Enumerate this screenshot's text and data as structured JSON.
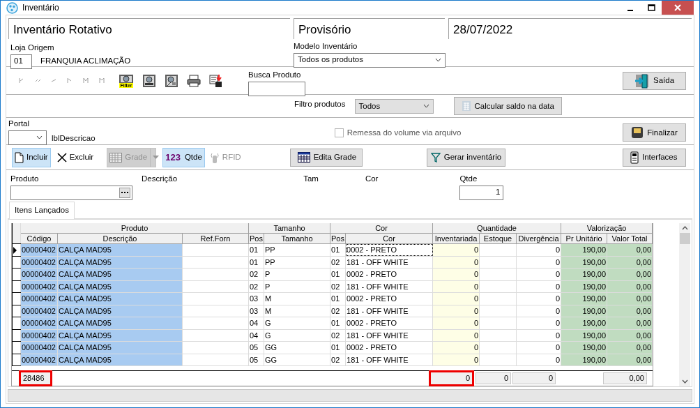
{
  "window": {
    "title": "Inventário"
  },
  "header": {
    "title": "Inventário Rotativo",
    "status": "Provisório",
    "date": "28/07/2022"
  },
  "loja": {
    "label": "Loja Origem",
    "code": "01",
    "name": "FRANQUIA ACLIMAÇÃO"
  },
  "modelo": {
    "label": "Modelo Inventário",
    "value": "Todos os produtos"
  },
  "nav_buttons": [
    {
      "kind": "first",
      "disabled": true
    },
    {
      "kind": "prior",
      "disabled": true
    },
    {
      "kind": "next",
      "disabled": true
    },
    {
      "kind": "last",
      "disabled": true
    },
    {
      "kind": "insert",
      "disabled": true
    },
    {
      "kind": "delete",
      "disabled": true
    }
  ],
  "tool_buttons": [
    {
      "kind": "filter",
      "label": "Filter"
    },
    {
      "kind": "report"
    },
    {
      "kind": "report-edit"
    },
    {
      "kind": "print"
    },
    {
      "kind": "export"
    }
  ],
  "busca": {
    "label": "Busca Produto"
  },
  "exit_button": {
    "label": "Saída"
  },
  "filter": {
    "label": "Filtro produtos",
    "value": "Todos"
  },
  "calc_button": {
    "label": "Calcular saldo na data"
  },
  "portal": {
    "label": "Portal",
    "description": "lblDescricao"
  },
  "remessa": {
    "label": "Remessa do volume via arquivo",
    "checked": false
  },
  "finish_button": {
    "label": "Finalizar"
  },
  "actions": [
    {
      "kind": "new",
      "label": "Incluir",
      "selected": true,
      "disabled": false
    },
    {
      "kind": "delete",
      "label": "Excluir",
      "selected": false,
      "disabled": false
    },
    {
      "kind": "grid",
      "label": "Grade",
      "selected": false,
      "disabled": true
    },
    {
      "kind": "qty",
      "prefix": "123",
      "label": "Qtde",
      "selected": true,
      "disabled": false
    },
    {
      "kind": "rfid",
      "label": "RFID",
      "selected": false,
      "disabled": true
    }
  ],
  "edit_grid_button": {
    "label": "Edita Grade"
  },
  "generate_button": {
    "label": "Gerar inventário"
  },
  "interfaces_button": {
    "label": "Interfaces"
  },
  "entry": {
    "produto": "Produto",
    "descricao": "Descrição",
    "tam": "Tam",
    "cor": "Cor",
    "qtde_label": "Qtde",
    "qtde_value": "1"
  },
  "tabs": [
    {
      "label": "Itens Lançados",
      "selected": true
    }
  ],
  "table": {
    "groups": [
      {
        "label": "Produto",
        "columns": [
          "Código",
          "Descrição",
          "Ref.Forn"
        ]
      },
      {
        "label": "Tamanho",
        "columns": [
          "Pos",
          "Tamanho"
        ]
      },
      {
        "label": "Cor",
        "columns": [
          "Pos",
          "Cor"
        ]
      },
      {
        "label": "Quantidade",
        "columns": [
          "Inventariada",
          "Estoque",
          "Divergência"
        ]
      },
      {
        "label": "Valorização",
        "columns": [
          "Pr Unitário",
          "Valor Total"
        ]
      }
    ],
    "rows": [
      {
        "selected": true,
        "cells": [
          "00000402",
          "CALÇA MAD95",
          null,
          "01",
          "PP",
          "01",
          "0002 - PRETO",
          "0",
          null,
          "0",
          "190,00",
          "0,00"
        ]
      },
      {
        "selected": false,
        "cells": [
          "00000402",
          "CALÇA MAD95",
          null,
          "01",
          "PP",
          "02",
          "181  - OFF WHITE",
          "0",
          null,
          "0",
          "190,00",
          "0,00"
        ]
      },
      {
        "selected": false,
        "cells": [
          "00000402",
          "CALÇA MAD95",
          null,
          "02",
          "P",
          "01",
          "0002 - PRETO",
          "0",
          null,
          "0",
          "190,00",
          "0,00"
        ]
      },
      {
        "selected": false,
        "cells": [
          "00000402",
          "CALÇA MAD95",
          null,
          "02",
          "P",
          "02",
          "181  - OFF WHITE",
          "0",
          null,
          "0",
          "190,00",
          "0,00"
        ]
      },
      {
        "selected": false,
        "cells": [
          "00000402",
          "CALÇA MAD95",
          null,
          "03",
          "M",
          "01",
          "0002 - PRETO",
          "0",
          null,
          "0",
          "190,00",
          "0,00"
        ]
      },
      {
        "selected": false,
        "cells": [
          "00000402",
          "CALÇA MAD95",
          null,
          "03",
          "M",
          "02",
          "181  - OFF WHITE",
          "0",
          null,
          "0",
          "190,00",
          "0,00"
        ]
      },
      {
        "selected": false,
        "cells": [
          "00000402",
          "CALÇA MAD95",
          null,
          "04",
          "G",
          "01",
          "0002 - PRETO",
          "0",
          null,
          "0",
          "190,00",
          "0,00"
        ]
      },
      {
        "selected": false,
        "cells": [
          "00000402",
          "CALÇA MAD95",
          null,
          "04",
          "G",
          "02",
          "181  - OFF WHITE",
          "0",
          null,
          "0",
          "190,00",
          "0,00"
        ]
      },
      {
        "selected": false,
        "cells": [
          "00000402",
          "CALÇA MAD95",
          null,
          "05",
          "GG",
          "01",
          "0002 - PRETO",
          "0",
          null,
          "0",
          "190,00",
          "0,00"
        ]
      },
      {
        "selected": false,
        "cells": [
          "00000402",
          "CALÇA MAD95",
          null,
          "05",
          "GG",
          "02",
          "181  - OFF WHITE",
          "0",
          null,
          "0",
          "190,00",
          "0,00"
        ]
      }
    ],
    "footer": [
      {
        "text": "28486",
        "highlighted": true
      },
      {
        "text": "0",
        "highlighted": true
      },
      {
        "text": "0",
        "highlighted": false
      },
      {
        "text": "0",
        "highlighted": false
      },
      {
        "text": "0,00",
        "highlighted": false
      }
    ]
  }
}
